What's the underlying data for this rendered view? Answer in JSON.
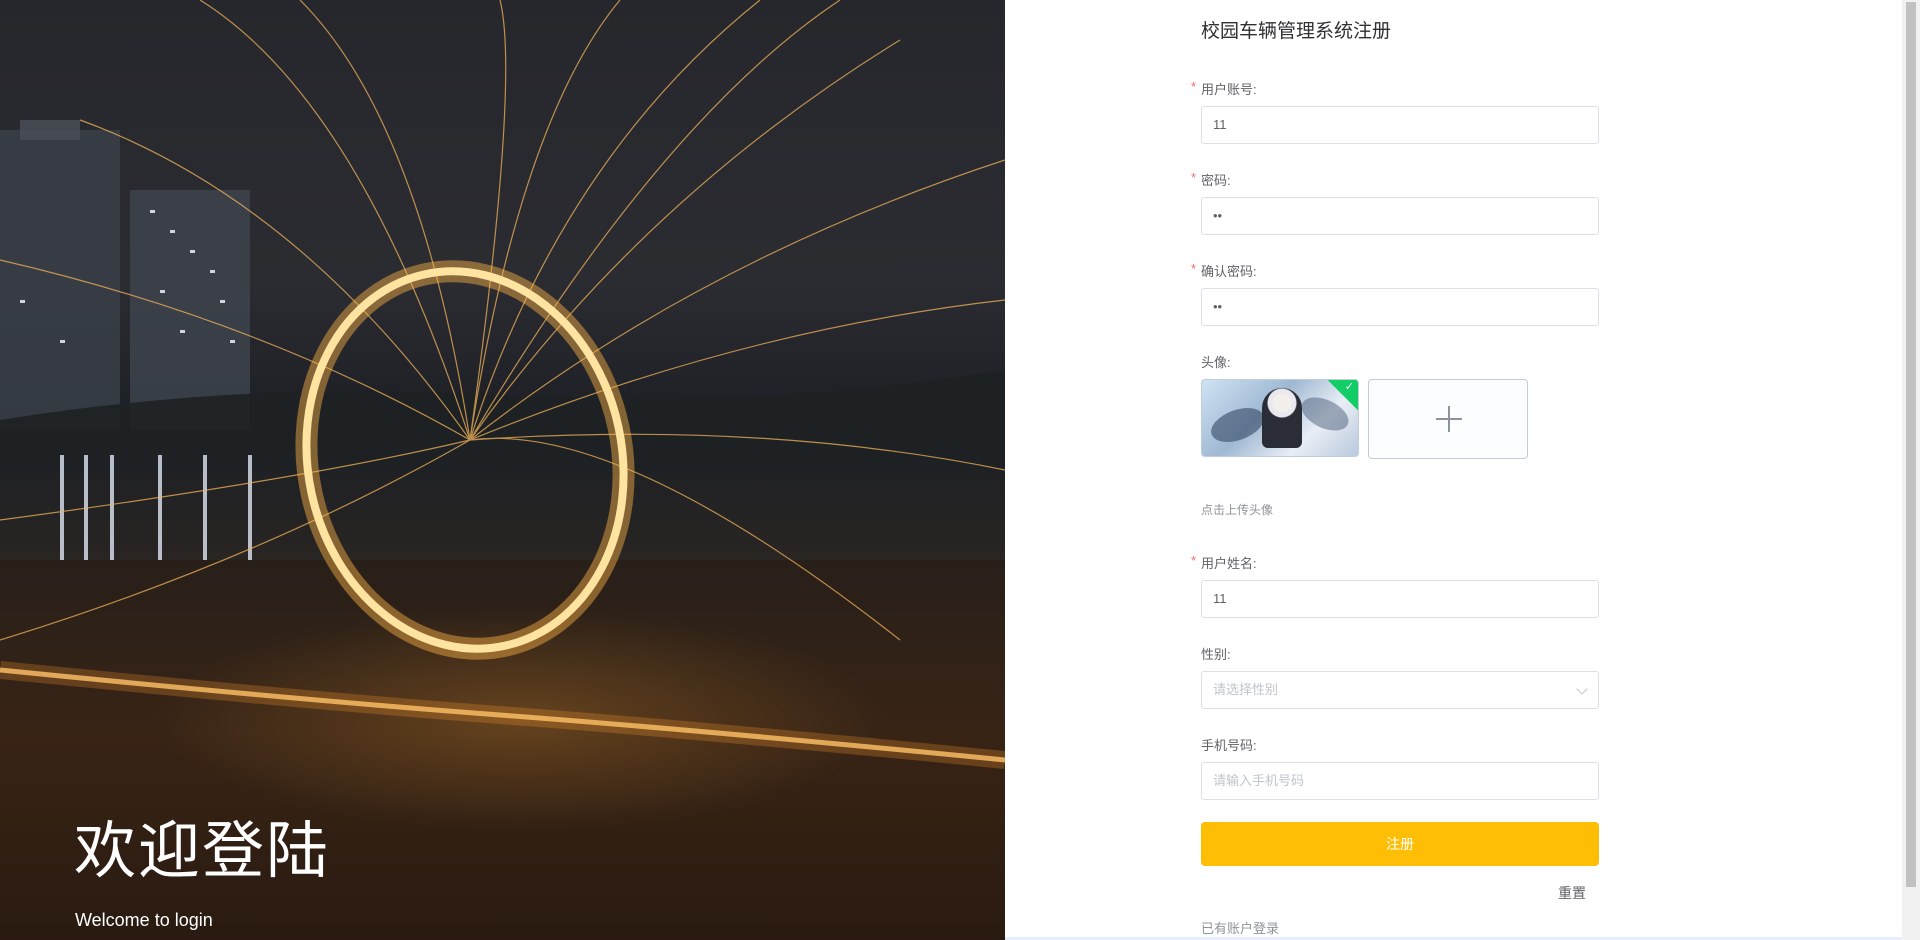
{
  "hero": {
    "title": "欢迎登陆",
    "subtitle": "Welcome to login"
  },
  "form": {
    "title": "校园车辆管理系统注册",
    "fields": {
      "account": {
        "label": "用户账号:",
        "value": "11",
        "required": true
      },
      "password": {
        "label": "密码:",
        "value": "••",
        "required": true
      },
      "confirm_password": {
        "label": "确认密码:",
        "value": "••",
        "required": true
      },
      "avatar": {
        "label": "头像:",
        "hint": "点击上传头像"
      },
      "name": {
        "label": "用户姓名:",
        "value": "11",
        "required": true
      },
      "gender": {
        "label": "性别:",
        "placeholder": "请选择性别"
      },
      "phone": {
        "label": "手机号码:",
        "placeholder": "请输入手机号码"
      }
    },
    "required_mark": "*",
    "submit_label": "注册",
    "reset_label": "重置",
    "login_link": "已有账户登录"
  },
  "icons": {
    "upload": "plus-icon",
    "select": "chevron-down-icon",
    "uploaded": "check-icon"
  },
  "colors": {
    "accent": "#ffbe06",
    "required": "#f56c6c",
    "success": "#13ce66"
  }
}
